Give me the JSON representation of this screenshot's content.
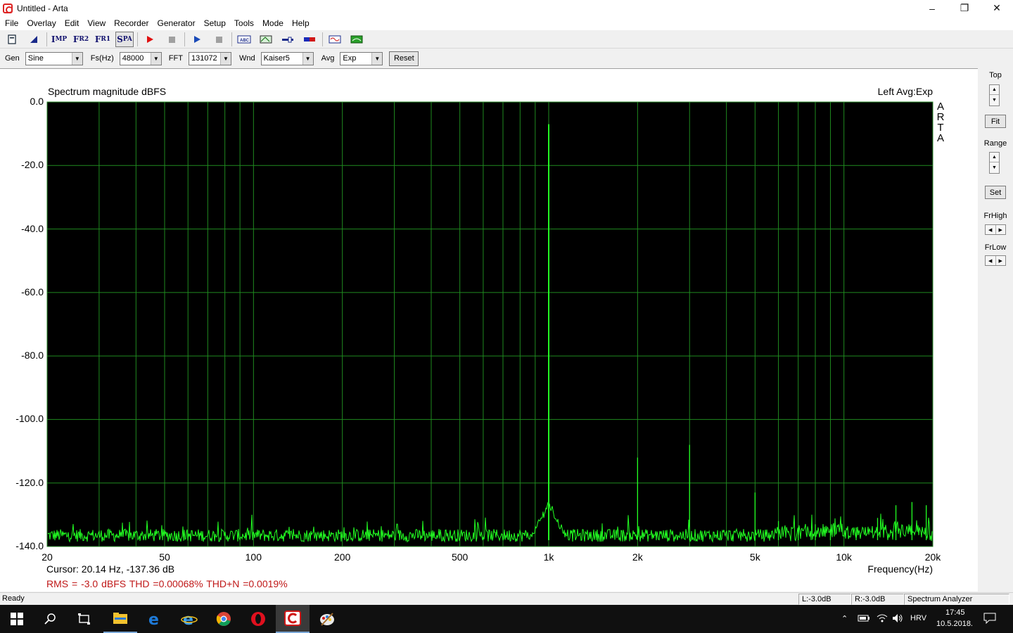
{
  "window": {
    "title": "Untitled - Arta",
    "controls": [
      "minimize",
      "maximize",
      "close"
    ]
  },
  "menu": [
    "File",
    "Overlay",
    "Edit",
    "View",
    "Recorder",
    "Generator",
    "Setup",
    "Tools",
    "Mode",
    "Help"
  ],
  "toolbar": {
    "mode_buttons": [
      {
        "label": "Imp",
        "icon": "impulse-mode-icon"
      },
      {
        "label": "Fr2",
        "icon": "fr2-mode-icon"
      },
      {
        "label": "Fr1",
        "icon": "fr1-mode-icon"
      },
      {
        "label": "Spa",
        "icon": "spa-mode-icon",
        "pressed": true
      }
    ]
  },
  "controls": {
    "gen_label": "Gen",
    "gen_value": "Sine",
    "fs_label": "Fs(Hz)",
    "fs_value": "48000",
    "fft_label": "FFT",
    "fft_value": "131072",
    "wnd_label": "Wnd",
    "wnd_value": "Kaiser5",
    "avg_label": "Avg",
    "avg_value": "Exp",
    "reset_label": "Reset"
  },
  "plot": {
    "title": "Spectrum magnitude dBFS",
    "status": "Left  Avg:Exp",
    "watermark": "ARTA",
    "x_axis_title": "Frequency(Hz)",
    "cursor_text": "Cursor: 20.14 Hz, -137.36 dB",
    "measurement_text": "RMS =   -3.0 dBFS   THD =0.00068%   THD+N =0.0019%",
    "trace_color": "#22ff22",
    "grid_color": "#1f8a1f",
    "background_color": "#000000",
    "measurement_color": "#c01818"
  },
  "chart_data": {
    "type": "line",
    "title": "Spectrum magnitude dBFS",
    "xlabel": "Frequency(Hz)",
    "ylabel": "",
    "x_scale": "log",
    "xlim": [
      20,
      20000
    ],
    "ylim": [
      -140,
      0
    ],
    "x_ticks": [
      20,
      50,
      100,
      200,
      500,
      1000,
      2000,
      5000,
      10000,
      20000
    ],
    "x_tick_labels": [
      "20",
      "50",
      "100",
      "200",
      "500",
      "1k",
      "2k",
      "5k",
      "10k",
      "20k"
    ],
    "y_ticks": [
      0,
      -20,
      -40,
      -60,
      -80,
      -100,
      -120,
      -140
    ],
    "y_tick_labels": [
      "0.0",
      "-20.0",
      "-40.0",
      "-60.0",
      "-80.0",
      "-100.0",
      "-120.0",
      "-140.0"
    ],
    "grid": true,
    "noise_floor_db": -138,
    "series": [
      {
        "peaks": [
          {
            "x": 1000,
            "y": -7
          },
          {
            "x": 2000,
            "y": -112
          },
          {
            "x": 3000,
            "y": -108
          },
          {
            "x": 5000,
            "y": -123
          },
          {
            "x": 6000,
            "y": -132
          },
          {
            "x": 7000,
            "y": -134
          },
          {
            "x": 8000,
            "y": -133
          },
          {
            "x": 9000,
            "y": -135
          },
          {
            "x": 11000,
            "y": -134
          },
          {
            "x": 13000,
            "y": -131
          },
          {
            "x": 15000,
            "y": -127
          },
          {
            "x": 17000,
            "y": -126
          },
          {
            "x": 19000,
            "y": -127
          }
        ]
      }
    ]
  },
  "right_panel": {
    "top_label": "Top",
    "fit_label": "Fit",
    "range_label": "Range",
    "set_label": "Set",
    "frhigh_label": "FrHigh",
    "frlow_label": "FrLow"
  },
  "statusbar": {
    "ready": "Ready",
    "left_level": "L:-3.0dB",
    "right_level": "R:-3.0dB",
    "mode": "Spectrum Analyzer"
  },
  "taskbar": {
    "lang": "HRV",
    "time": "17:45",
    "date": "10.5.2018."
  }
}
